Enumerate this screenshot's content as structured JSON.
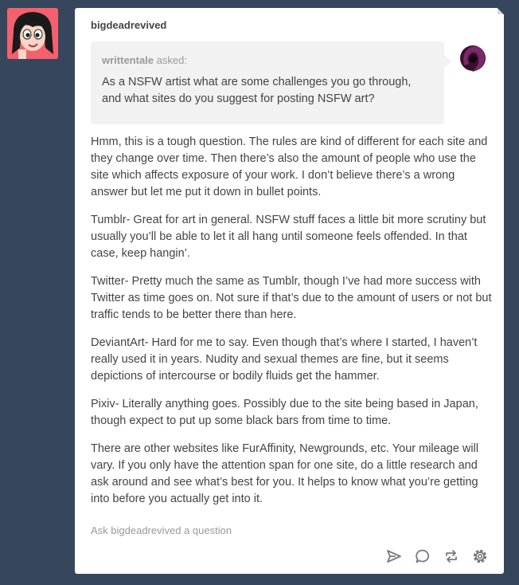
{
  "post": {
    "username": "bigdeadrevived",
    "ask": {
      "asker": "writtentale",
      "asked_suffix": " asked:",
      "question": "As a NSFW artist what are some challenges you go through, and what sites do you suggest for posting NSFW art?"
    },
    "answer": [
      "Hmm, this is a tough question.  The rules are kind of different for each site and they change over time.  Then there’s also the amount of people who use the site which affects exposure of your work.  I don’t believe there’s a wrong answer but let me put it down in bullet points.",
      "Tumblr-  Great for art in general.  NSFW stuff faces a little bit more scrutiny but usually you’ll be able to let it all hang until someone feels offended.  In that case, keep hangin’.",
      "Twitter-  Pretty much the same as Tumblr, though I’ve had more success with Twitter as time goes on.  Not sure if that’s due to the amount of users or not but traffic tends to be better there than here.",
      "DeviantArt-  Hard for me to say.  Even though that’s where I started, I haven’t really used it in years.  Nudity and sexual themes are fine, but it seems depictions of intercourse or bodily fluids get the hammer.",
      "Pixiv- Literally anything goes.  Possibly due to the site being based in Japan, though expect to put up some black bars from time to time.",
      "There are other websites like FurAffinity, Newgrounds, etc.  Your mileage will vary.  If you only have the attention span for one site, do a little research and ask around and see what’s best for you.  It helps to know what you’re getting into before you actually get into it."
    ],
    "ask_link": "Ask bigdeadrevived a question"
  },
  "icons": [
    "share-icon",
    "reply-icon",
    "reblog-icon",
    "settings-icon"
  ],
  "colors": {
    "background": "#36465d",
    "card": "#ffffff",
    "ask_box": "#f2f2f2",
    "text": "#444444",
    "muted": "#9a9a9a"
  }
}
